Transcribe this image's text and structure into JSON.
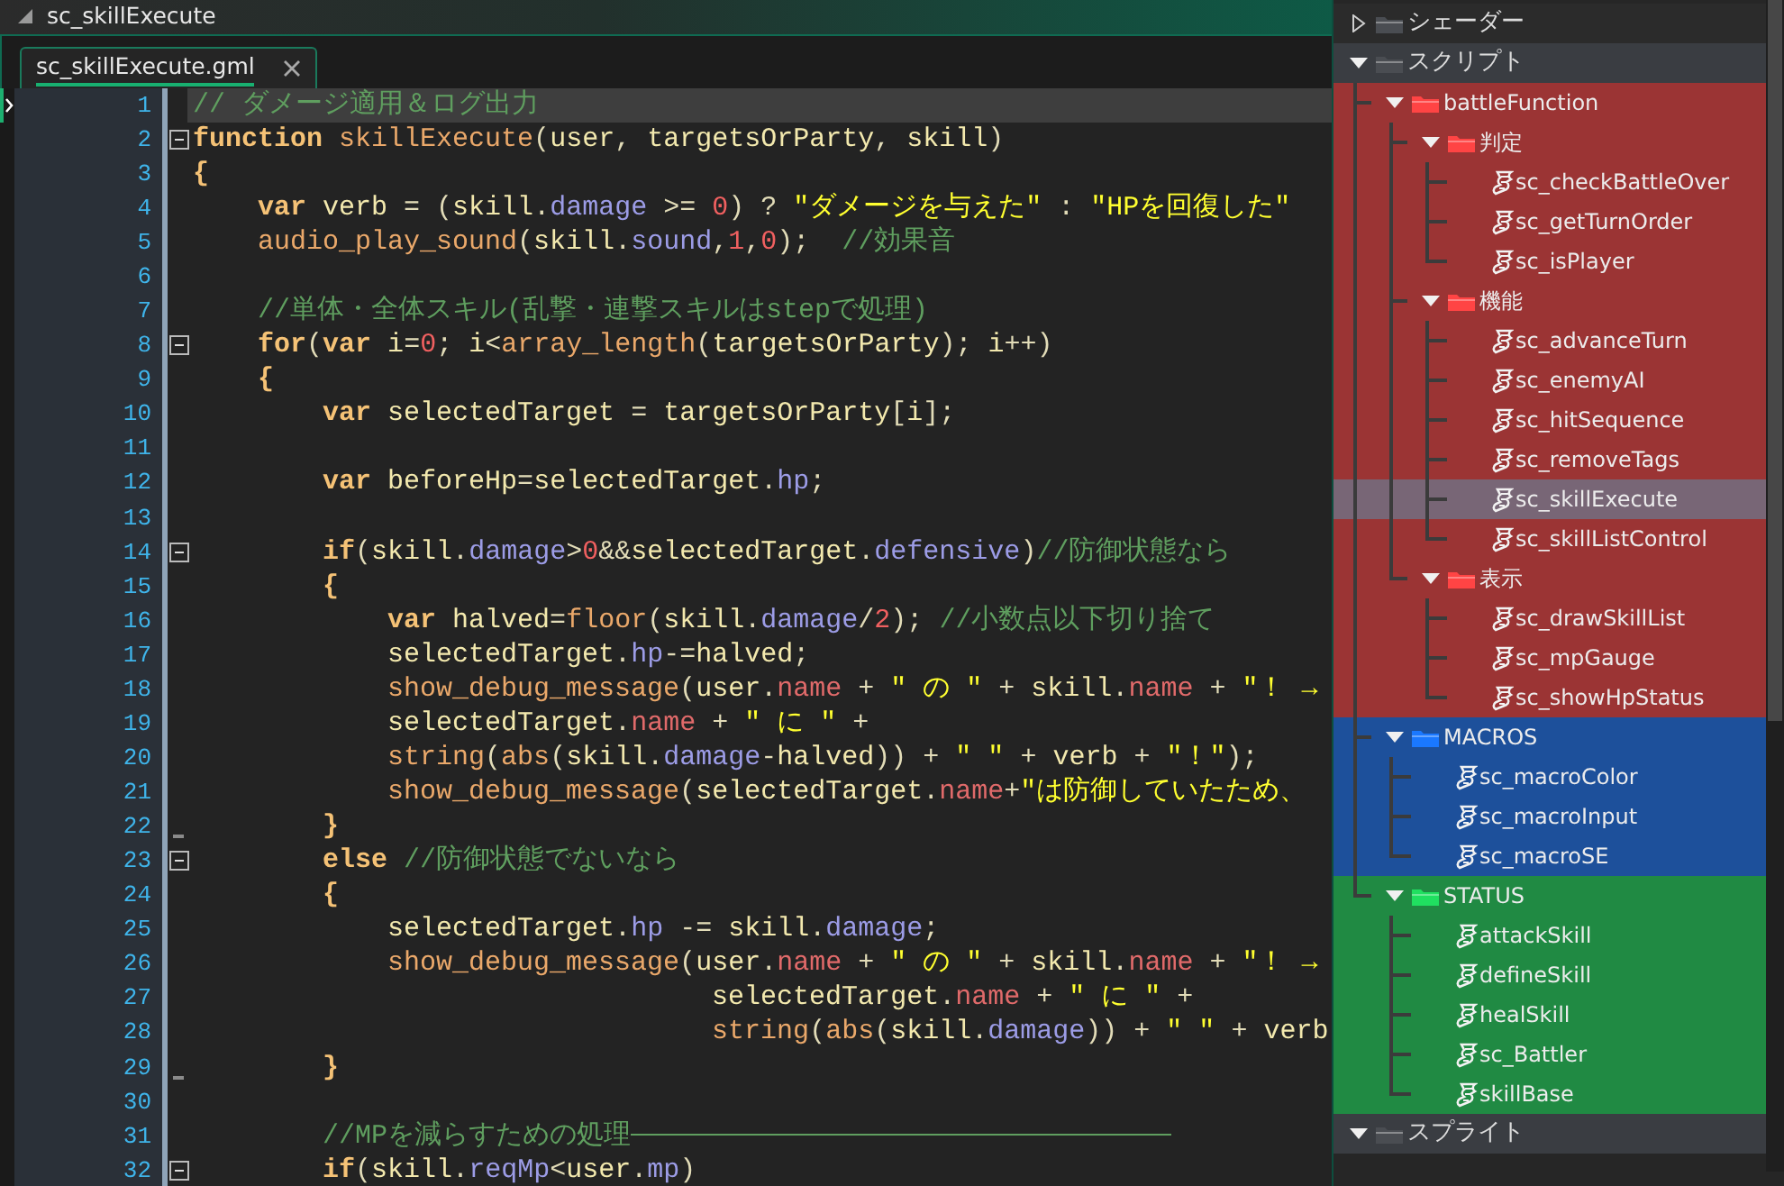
{
  "window": {
    "title": "sc_skillExecute"
  },
  "tabs": [
    {
      "label": "sc_skillExecute.gml",
      "selected": true
    }
  ],
  "editor": {
    "lines": [
      {
        "number": "1",
        "selected": true,
        "tokens": [
          {
            "kind": "cm",
            "text": "// ダメージ適用＆ログ出力"
          }
        ]
      },
      {
        "number": "2",
        "selected": false,
        "foldable": true,
        "tokens": [
          {
            "kind": "kw",
            "text": "function"
          },
          {
            "kind": "fn",
            "text": " skillExecute"
          },
          {
            "kind": "p",
            "text": "("
          },
          {
            "kind": "id",
            "text": "user"
          },
          {
            "kind": "p",
            "text": ", "
          },
          {
            "kind": "id",
            "text": "targetsOrParty"
          },
          {
            "kind": "p",
            "text": ", "
          },
          {
            "kind": "id",
            "text": "skill"
          },
          {
            "kind": "p",
            "text": ")"
          }
        ]
      },
      {
        "number": "3",
        "selected": false,
        "tokens": [
          {
            "kind": "br",
            "text": "{"
          }
        ]
      },
      {
        "number": "4",
        "selected": false,
        "tokens": [
          {
            "kind": "kw",
            "text": "    var"
          },
          {
            "kind": "id",
            "text": " verb"
          },
          {
            "kind": "p",
            "text": " = ("
          },
          {
            "kind": "id",
            "text": "skill"
          },
          {
            "kind": "p",
            "text": "."
          },
          {
            "kind": "prop",
            "text": "damage"
          },
          {
            "kind": "p",
            "text": " >= "
          },
          {
            "kind": "num",
            "text": "0"
          },
          {
            "kind": "p",
            "text": ") ? "
          },
          {
            "kind": "str",
            "text": "\"ダメージを与えた\""
          },
          {
            "kind": "p",
            "text": " : "
          },
          {
            "kind": "str",
            "text": "\"HPを回復した\""
          }
        ]
      },
      {
        "number": "5",
        "selected": false,
        "tokens": [
          {
            "kind": "fn",
            "text": "    audio_play_sound"
          },
          {
            "kind": "p",
            "text": "("
          },
          {
            "kind": "id",
            "text": "skill"
          },
          {
            "kind": "p",
            "text": "."
          },
          {
            "kind": "prop",
            "text": "sound"
          },
          {
            "kind": "p",
            "text": ","
          },
          {
            "kind": "num",
            "text": "1"
          },
          {
            "kind": "p",
            "text": ","
          },
          {
            "kind": "num",
            "text": "0"
          },
          {
            "kind": "p",
            "text": ");"
          },
          {
            "kind": "cm",
            "text": "  //効果音"
          }
        ]
      },
      {
        "number": "6",
        "selected": false
      },
      {
        "number": "7",
        "selected": false,
        "tokens": [
          {
            "kind": "cm",
            "text": "    //単体・全体スキル(乱撃・連撃スキルはstepで処理)"
          }
        ]
      },
      {
        "number": "8",
        "selected": false,
        "foldable": true,
        "tokens": [
          {
            "kind": "kw",
            "text": "    for"
          },
          {
            "kind": "p",
            "text": "("
          },
          {
            "kind": "kw",
            "text": "var"
          },
          {
            "kind": "id",
            "text": " i"
          },
          {
            "kind": "p",
            "text": "="
          },
          {
            "kind": "num",
            "text": "0"
          },
          {
            "kind": "p",
            "text": "; "
          },
          {
            "kind": "id",
            "text": "i"
          },
          {
            "kind": "p",
            "text": "<"
          },
          {
            "kind": "fn",
            "text": "array_length"
          },
          {
            "kind": "p",
            "text": "("
          },
          {
            "kind": "id",
            "text": "targetsOrParty"
          },
          {
            "kind": "p",
            "text": "); "
          },
          {
            "kind": "id",
            "text": "i"
          },
          {
            "kind": "p",
            "text": "++)"
          }
        ]
      },
      {
        "number": "9",
        "selected": false,
        "tokens": [
          {
            "kind": "br",
            "text": "    {"
          }
        ]
      },
      {
        "number": "10",
        "selected": false,
        "tokens": [
          {
            "kind": "kw",
            "text": "        var"
          },
          {
            "kind": "id",
            "text": " selectedTarget"
          },
          {
            "kind": "p",
            "text": " = "
          },
          {
            "kind": "id",
            "text": "targetsOrParty"
          },
          {
            "kind": "p",
            "text": "["
          },
          {
            "kind": "id",
            "text": "i"
          },
          {
            "kind": "p",
            "text": "];"
          }
        ]
      },
      {
        "number": "11",
        "selected": false
      },
      {
        "number": "12",
        "selected": false,
        "tokens": [
          {
            "kind": "kw",
            "text": "        var"
          },
          {
            "kind": "id",
            "text": " beforeHp"
          },
          {
            "kind": "p",
            "text": "="
          },
          {
            "kind": "id",
            "text": "selectedTarget"
          },
          {
            "kind": "p",
            "text": "."
          },
          {
            "kind": "prop",
            "text": "hp"
          },
          {
            "kind": "p",
            "text": ";"
          }
        ]
      },
      {
        "number": "13",
        "selected": false
      },
      {
        "number": "14",
        "selected": false,
        "foldable": true,
        "tokens": [
          {
            "kind": "kw",
            "text": "        if"
          },
          {
            "kind": "p",
            "text": "("
          },
          {
            "kind": "id",
            "text": "skill"
          },
          {
            "kind": "p",
            "text": "."
          },
          {
            "kind": "prop",
            "text": "damage"
          },
          {
            "kind": "p",
            "text": ">"
          },
          {
            "kind": "num",
            "text": "0"
          },
          {
            "kind": "p",
            "text": "&&"
          },
          {
            "kind": "id",
            "text": "selectedTarget"
          },
          {
            "kind": "p",
            "text": "."
          },
          {
            "kind": "prop",
            "text": "defensive"
          },
          {
            "kind": "p",
            "text": ")"
          },
          {
            "kind": "cm",
            "text": "//防御状態なら"
          }
        ]
      },
      {
        "number": "15",
        "selected": false,
        "tokens": [
          {
            "kind": "br",
            "text": "        {"
          }
        ]
      },
      {
        "number": "16",
        "selected": false,
        "tokens": [
          {
            "kind": "kw",
            "text": "            var"
          },
          {
            "kind": "id",
            "text": " halved"
          },
          {
            "kind": "p",
            "text": "="
          },
          {
            "kind": "fn",
            "text": "floor"
          },
          {
            "kind": "p",
            "text": "("
          },
          {
            "kind": "id",
            "text": "skill"
          },
          {
            "kind": "p",
            "text": "."
          },
          {
            "kind": "prop",
            "text": "damage"
          },
          {
            "kind": "p",
            "text": "/"
          },
          {
            "kind": "num",
            "text": "2"
          },
          {
            "kind": "p",
            "text": ");"
          },
          {
            "kind": "cm",
            "text": " //小数点以下切り捨て"
          }
        ]
      },
      {
        "number": "17",
        "selected": false,
        "tokens": [
          {
            "kind": "id",
            "text": "            selectedTarget"
          },
          {
            "kind": "p",
            "text": "."
          },
          {
            "kind": "prop",
            "text": "hp"
          },
          {
            "kind": "p",
            "text": "-="
          },
          {
            "kind": "id",
            "text": "halved"
          },
          {
            "kind": "p",
            "text": ";"
          }
        ]
      },
      {
        "number": "18",
        "selected": false,
        "tokens": [
          {
            "kind": "fn",
            "text": "            show_debug_message"
          },
          {
            "kind": "p",
            "text": "("
          },
          {
            "kind": "id",
            "text": "user"
          },
          {
            "kind": "p",
            "text": "."
          },
          {
            "kind": "nm",
            "text": "name"
          },
          {
            "kind": "p",
            "text": " + "
          },
          {
            "kind": "str",
            "text": "\" の \""
          },
          {
            "kind": "p",
            "text": " + "
          },
          {
            "kind": "id",
            "text": "skill"
          },
          {
            "kind": "p",
            "text": "."
          },
          {
            "kind": "nm",
            "text": "name"
          },
          {
            "kind": "p",
            "text": " + "
          },
          {
            "kind": "str",
            "text": "\"！ →"
          }
        ]
      },
      {
        "number": "19",
        "selected": false,
        "tokens": [
          {
            "kind": "id",
            "text": "            selectedTarget"
          },
          {
            "kind": "p",
            "text": "."
          },
          {
            "kind": "nm",
            "text": "name"
          },
          {
            "kind": "p",
            "text": " + "
          },
          {
            "kind": "str",
            "text": "\" に \""
          },
          {
            "kind": "p",
            "text": " +"
          }
        ]
      },
      {
        "number": "20",
        "selected": false,
        "tokens": [
          {
            "kind": "fn",
            "text": "            string"
          },
          {
            "kind": "p",
            "text": "("
          },
          {
            "kind": "fn",
            "text": "abs"
          },
          {
            "kind": "p",
            "text": "("
          },
          {
            "kind": "id",
            "text": "skill"
          },
          {
            "kind": "p",
            "text": "."
          },
          {
            "kind": "prop",
            "text": "damage"
          },
          {
            "kind": "p",
            "text": "-"
          },
          {
            "kind": "id",
            "text": "halved"
          },
          {
            "kind": "p",
            "text": ")) + "
          },
          {
            "kind": "str",
            "text": "\" \""
          },
          {
            "kind": "p",
            "text": " + "
          },
          {
            "kind": "id",
            "text": "verb"
          },
          {
            "kind": "p",
            "text": " + "
          },
          {
            "kind": "str",
            "text": "\"！\""
          },
          {
            "kind": "p",
            "text": ");"
          }
        ]
      },
      {
        "number": "21",
        "selected": false,
        "tokens": [
          {
            "kind": "fn",
            "text": "            show_debug_message"
          },
          {
            "kind": "p",
            "text": "("
          },
          {
            "kind": "id",
            "text": "selectedTarget"
          },
          {
            "kind": "p",
            "text": "."
          },
          {
            "kind": "nm",
            "text": "name"
          },
          {
            "kind": "p",
            "text": "+"
          },
          {
            "kind": "str",
            "text": "\"は防御していたため、"
          }
        ]
      },
      {
        "number": "22",
        "selected": false,
        "block_end": true,
        "tokens": [
          {
            "kind": "br",
            "text": "        }"
          }
        ]
      },
      {
        "number": "23",
        "selected": false,
        "foldable": true,
        "tokens": [
          {
            "kind": "kw",
            "text": "        else"
          },
          {
            "kind": "cm",
            "text": " //防御状態でないなら"
          }
        ]
      },
      {
        "number": "24",
        "selected": false,
        "tokens": [
          {
            "kind": "br",
            "text": "        {"
          }
        ]
      },
      {
        "number": "25",
        "selected": false,
        "tokens": [
          {
            "kind": "id",
            "text": "            selectedTarget"
          },
          {
            "kind": "p",
            "text": "."
          },
          {
            "kind": "prop",
            "text": "hp"
          },
          {
            "kind": "p",
            "text": " -= "
          },
          {
            "kind": "id",
            "text": "skill"
          },
          {
            "kind": "p",
            "text": "."
          },
          {
            "kind": "prop",
            "text": "damage"
          },
          {
            "kind": "p",
            "text": ";"
          }
        ]
      },
      {
        "number": "26",
        "selected": false,
        "tokens": [
          {
            "kind": "fn",
            "text": "            show_debug_message"
          },
          {
            "kind": "p",
            "text": "("
          },
          {
            "kind": "id",
            "text": "user"
          },
          {
            "kind": "p",
            "text": "."
          },
          {
            "kind": "nm",
            "text": "name"
          },
          {
            "kind": "p",
            "text": " + "
          },
          {
            "kind": "str",
            "text": "\" の \""
          },
          {
            "kind": "p",
            "text": " + "
          },
          {
            "kind": "id",
            "text": "skill"
          },
          {
            "kind": "p",
            "text": "."
          },
          {
            "kind": "nm",
            "text": "name"
          },
          {
            "kind": "p",
            "text": " + "
          },
          {
            "kind": "str",
            "text": "\"！ →"
          }
        ]
      },
      {
        "number": "27",
        "selected": false,
        "tokens": [
          {
            "kind": "id",
            "text": "                                selectedTarget"
          },
          {
            "kind": "p",
            "text": "."
          },
          {
            "kind": "nm",
            "text": "name"
          },
          {
            "kind": "p",
            "text": " + "
          },
          {
            "kind": "str",
            "text": "\" に \""
          },
          {
            "kind": "p",
            "text": " +"
          }
        ]
      },
      {
        "number": "28",
        "selected": false,
        "tokens": [
          {
            "kind": "fn",
            "text": "                                string"
          },
          {
            "kind": "p",
            "text": "("
          },
          {
            "kind": "fn",
            "text": "abs"
          },
          {
            "kind": "p",
            "text": "("
          },
          {
            "kind": "id",
            "text": "skill"
          },
          {
            "kind": "p",
            "text": "."
          },
          {
            "kind": "prop",
            "text": "damage"
          },
          {
            "kind": "p",
            "text": ")) + "
          },
          {
            "kind": "str",
            "text": "\" \""
          },
          {
            "kind": "p",
            "text": " + "
          },
          {
            "kind": "id",
            "text": "verb"
          }
        ]
      },
      {
        "number": "29",
        "selected": false,
        "block_end": true,
        "tokens": [
          {
            "kind": "br",
            "text": "        }"
          }
        ]
      },
      {
        "number": "30",
        "selected": false
      },
      {
        "number": "31",
        "selected": false,
        "trailing_rule": true,
        "tokens": [
          {
            "kind": "cm",
            "text": "        //MPを減らすための処理"
          }
        ]
      },
      {
        "number": "32",
        "selected": false,
        "foldable": true,
        "tokens": [
          {
            "kind": "kw",
            "text": "        if"
          },
          {
            "kind": "p",
            "text": "("
          },
          {
            "kind": "id",
            "text": "skill"
          },
          {
            "kind": "p",
            "text": "."
          },
          {
            "kind": "prop",
            "text": "reqMp"
          },
          {
            "kind": "p",
            "text": "<"
          },
          {
            "kind": "id",
            "text": "user"
          },
          {
            "kind": "p",
            "text": "."
          },
          {
            "kind": "prop",
            "text": "mp"
          },
          {
            "kind": "p",
            "text": ")"
          }
        ]
      }
    ]
  },
  "tree": {
    "items": [
      {
        "kind": "folder",
        "label": "シェーダー",
        "expanded": false,
        "selected": false
      },
      {
        "kind": "folder",
        "label": "スクリプト",
        "expanded": true,
        "selected": false,
        "children": [
          {
            "kind": "folder",
            "label": "battleFunction",
            "color": "#ff4444",
            "expanded": true,
            "selected": false,
            "children": [
              {
                "kind": "folder",
                "label": "判定",
                "color": "#ff4444",
                "expanded": true,
                "selected": false,
                "children": [
                  {
                    "kind": "script",
                    "label": "sc_checkBattleOver",
                    "selected": false
                  },
                  {
                    "kind": "script",
                    "label": "sc_getTurnOrder",
                    "selected": false
                  },
                  {
                    "kind": "script",
                    "label": "sc_isPlayer",
                    "selected": false
                  }
                ]
              },
              {
                "kind": "folder",
                "label": "機能",
                "color": "#ff4444",
                "expanded": true,
                "selected": false,
                "children": [
                  {
                    "kind": "script",
                    "label": "sc_advanceTurn",
                    "selected": false
                  },
                  {
                    "kind": "script",
                    "label": "sc_enemyAI",
                    "selected": false
                  },
                  {
                    "kind": "script",
                    "label": "sc_hitSequence",
                    "selected": false
                  },
                  {
                    "kind": "script",
                    "label": "sc_removeTags",
                    "selected": false
                  },
                  {
                    "kind": "script",
                    "label": "sc_skillExecute",
                    "selected": true
                  },
                  {
                    "kind": "script",
                    "label": "sc_skillListControl",
                    "selected": false
                  }
                ]
              },
              {
                "kind": "folder",
                "label": "表示",
                "color": "#ff4444",
                "expanded": true,
                "selected": false,
                "children": [
                  {
                    "kind": "script",
                    "label": "sc_drawSkillList",
                    "selected": false
                  },
                  {
                    "kind": "script",
                    "label": "sc_mpGauge",
                    "selected": false
                  },
                  {
                    "kind": "script",
                    "label": "sc_showHpStatus",
                    "selected": false
                  }
                ]
              }
            ]
          },
          {
            "kind": "folder",
            "label": "MACROS",
            "color": "#1a78ff",
            "expanded": true,
            "selected": false,
            "children": [
              {
                "kind": "script",
                "label": "sc_macroColor",
                "selected": false
              },
              {
                "kind": "script",
                "label": "sc_macroInput",
                "selected": false
              },
              {
                "kind": "script",
                "label": "sc_macroSE",
                "selected": false
              }
            ]
          },
          {
            "kind": "folder",
            "label": "STATUS",
            "color": "#20e060",
            "expanded": true,
            "selected": false,
            "children": [
              {
                "kind": "script",
                "label": "attackSkill",
                "selected": false
              },
              {
                "kind": "script",
                "label": "defineSkill",
                "selected": false
              },
              {
                "kind": "script",
                "label": "healSkill",
                "selected": false
              },
              {
                "kind": "script",
                "label": "sc_Battler",
                "selected": false
              },
              {
                "kind": "script",
                "label": "skillBase",
                "selected": false
              }
            ]
          }
        ]
      },
      {
        "kind": "folder",
        "label": "スプライト",
        "expanded": true,
        "selected": false
      }
    ]
  }
}
